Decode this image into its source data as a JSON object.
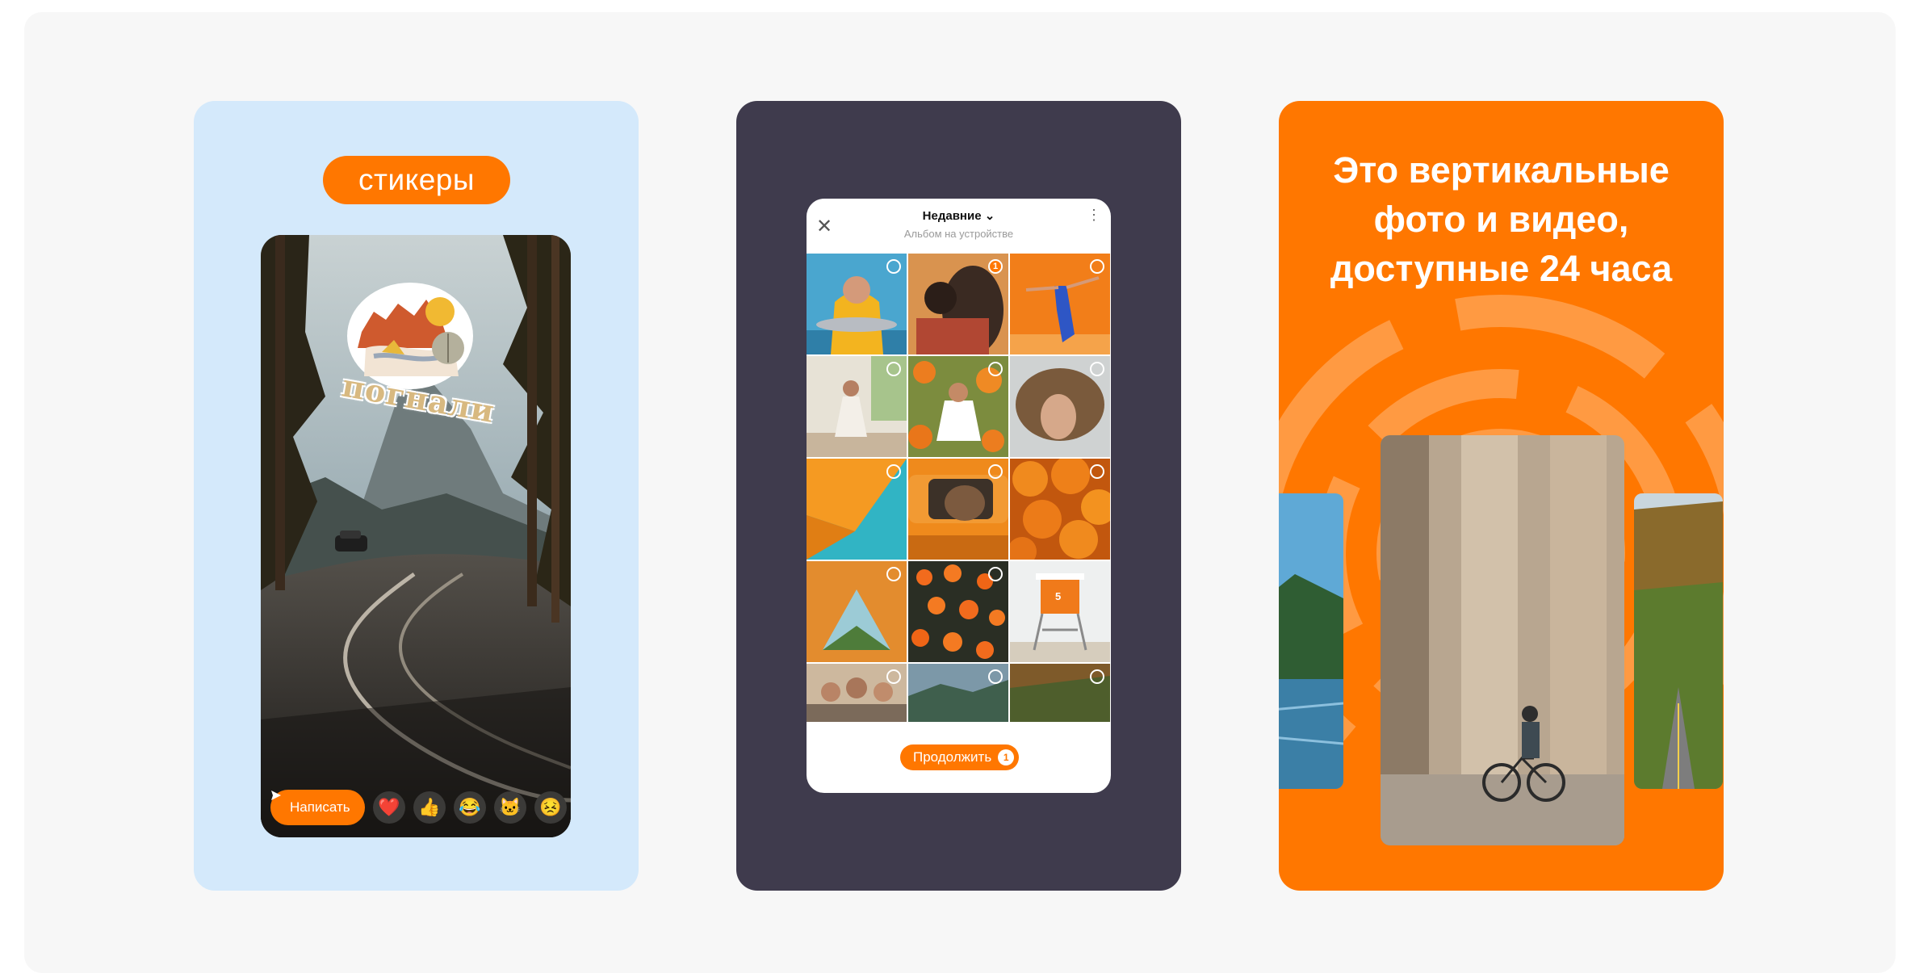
{
  "cards": {
    "stickers": {
      "pill_label": "стикеры",
      "sticker_text": "погнали",
      "write_label": "Написать",
      "reactions": [
        "❤️",
        "👍",
        "😂",
        "🐱",
        "😣"
      ]
    },
    "gallery": {
      "title": "Недавние",
      "subtitle": "Альбом на устройстве",
      "selected_count": "1",
      "continue_label": "Продолжить",
      "continue_count": "1",
      "lifeguard_number": "5"
    },
    "stories": {
      "headline_line1": "Это вертикальные",
      "headline_line2": "фото и видео,",
      "headline_line3": "доступные 24 часа"
    }
  },
  "colors": {
    "accent": "#ff7700",
    "stickers_bg": "#d4e9fb",
    "gallery_bg": "#3f3b4d",
    "page_panel": "#f7f7f7"
  }
}
